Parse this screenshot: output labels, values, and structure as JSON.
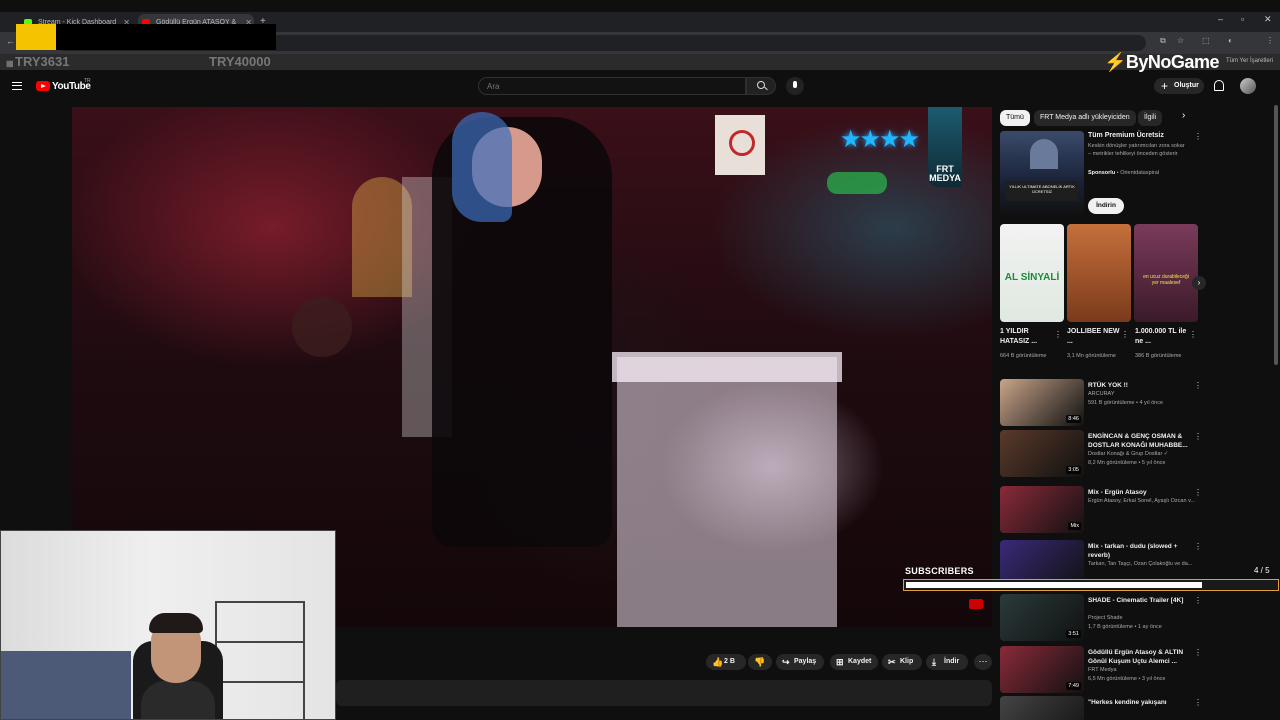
{
  "browser": {
    "tabs": [
      {
        "label": "Stream - Kick Dashboard"
      },
      {
        "label": "Gödüllü Ergün ATASOY & KAL..."
      }
    ],
    "bookmarks_right": "Tüm Yer İşaretleri"
  },
  "overlay": {
    "ticker_left": "TRY3631",
    "ticker_right": "TRY40000",
    "brand": "ByNoGame",
    "subscribers_label": "SUBSCRIBERS",
    "subscribers_count": "4 / 5",
    "subscribers_progress": 0.8
  },
  "youtube": {
    "logo_text": "YouTube",
    "logo_region": "TR",
    "search_placeholder": "Ara",
    "create_label": "Oluştur"
  },
  "video": {
    "watermark": "FRT MEDYA",
    "actions": {
      "likes": "2 B",
      "share": "Paylaş",
      "save": "Kaydet",
      "clip": "Klip",
      "download": "İndir"
    }
  },
  "sidebar": {
    "chips": [
      "Tümü",
      "FRT Medya adlı yükleyiciden",
      "İlgili"
    ],
    "ad": {
      "title": "Tüm Premium Ücretsiz",
      "description": "Keskin dönüşler yatırımcıları zora sokar – metrikler tehlikeyi önceden gösterir",
      "sponsor_label": "Sponsorlu",
      "sponsor_name": "Orientdataspiral",
      "button": "İndirin",
      "thumb_text": "YILLIK ULTIMATE ABONELİK ARTIK ÜCRETSİZ"
    },
    "shorts": [
      {
        "title": "1 YILDIR HATASIZ ...",
        "views": "664 B görüntüleme",
        "thumb_text": "AL SİNYALİ",
        "color": "#2aa84a"
      },
      {
        "title": "JOLLIBEE NEW ...",
        "views": "3,1 Mn görüntüleme",
        "thumb_text": "",
        "color": "#b8562b"
      },
      {
        "title": "1.000.000 TL ile ne ...",
        "views": "386 B görüntüleme",
        "thumb_text": "en ucuz durabileceği yer maalesef",
        "color": "#7a3b5a"
      }
    ],
    "videos": [
      {
        "title": "RTÜK YOK !!",
        "channel": "ARCURAY",
        "meta": "591 B görüntüleme • 4 yıl önce",
        "duration": "8:46",
        "color": "#c8a58a"
      },
      {
        "title": "ENGİNCAN & GENÇ OSMAN & DOSTLAR KONAĞI MUHABBE...",
        "channel": "Dostlar Konağı & Grup Dostlar ✓",
        "meta": "8,2 Mn görüntüleme • 5 yıl önce",
        "duration": "3:05",
        "color": "#5a3a2a"
      },
      {
        "title": "Mix - Ergün Atasoy",
        "channel": "Ergün Atasoy, Erkal Sonel, Ayaşlı Özcan v...",
        "meta": "",
        "duration": "Mix",
        "color": "#8a2a3a"
      },
      {
        "title": "Mix - tarkan - dudu (slowed + reverb)",
        "channel": "Tarkan, Tan Taşçı, Ozan Çolakoğlu ve da...",
        "meta": "",
        "duration": "",
        "color": "#3a2a7a"
      },
      {
        "title": "SHADE - Cinematic Trailer [4K]",
        "channel": "Project Shade",
        "meta": "1,7 B görüntüleme • 1 ay önce",
        "duration": "3:51",
        "color": "#2a3a3a"
      },
      {
        "title": "Gödüllü Ergün Atasoy & ALTIN Gönül Kuşum Uçtu Alemci ...",
        "channel": "FRT Medya",
        "meta": "6,5 Mn görüntüleme • 3 yıl önce",
        "duration": "7:49",
        "color": "#8a2a3a"
      },
      {
        "title": "\"Herkes kendine yakışanı",
        "channel": "",
        "meta": "",
        "duration": "",
        "color": "#444"
      }
    ]
  }
}
